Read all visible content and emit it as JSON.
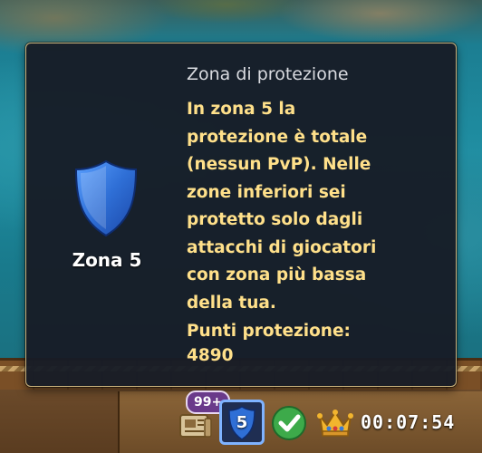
{
  "tooltip": {
    "zone_label": "Zona 5",
    "title": "Zona di protezione",
    "body": "In zona 5 la\nprotezione è totale\n(nessun PvP). Nelle\nzone inferiori sei\nprotetto solo dagli\nattacchi di giocatori\ncon zona più bassa\ndella tua.",
    "points_label": "Punti protezione:",
    "points_value": "4890",
    "shield_icon": "shield-icon",
    "shield_color": "#2f6fd6"
  },
  "hud": {
    "news_badge": "99+",
    "news_icon": "news-icon",
    "zone_number": "5",
    "check_icon": "check-icon",
    "crown_icon": "crown-icon",
    "timer": "00:07:54"
  }
}
